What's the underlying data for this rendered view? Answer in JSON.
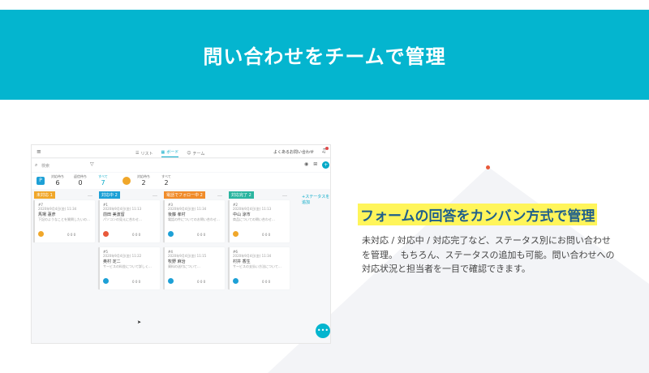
{
  "banner": {
    "title": "問い合わせをチームで管理"
  },
  "app": {
    "menu_icon": "hamburger-icon",
    "tabs": [
      {
        "label": "リスト",
        "icon": "list-icon",
        "active": false
      },
      {
        "label": "ボード",
        "icon": "board-icon",
        "active": true
      },
      {
        "label": "チーム",
        "icon": "team-icon",
        "active": false
      }
    ],
    "faq": "よくあるお問い合わせ",
    "search_placeholder": "検索",
    "stats": [
      {
        "label": "対応待ち",
        "value": "6"
      },
      {
        "label": "返信待ち",
        "value": "0"
      },
      {
        "label": "すべて",
        "value": "7",
        "active": true
      },
      {
        "label": "対応待ち",
        "value": "2"
      },
      {
        "label": "すべて",
        "value": "2"
      }
    ],
    "stat_badge": "P",
    "columns": [
      {
        "label": "未対応",
        "count": "1",
        "color": "#f0a72a"
      },
      {
        "label": "対応中",
        "count": "2",
        "color": "#1da0d6"
      },
      {
        "label": "電話でフォロー中",
        "count": "2",
        "color": "#f08c2a"
      },
      {
        "label": "対応完了",
        "count": "2",
        "color": "#2bb5a0"
      }
    ],
    "add_status": "+ステータスを追加",
    "cards": [
      {
        "no": "#7",
        "date": "2020年9月4日(金) 11:34",
        "name": "馬場 蓮彦",
        "desc": "下記のようなことを質問したいの…",
        "foot": "0 0 0"
      },
      {
        "no": "#1",
        "date": "2020年9月4日(金) 11:13",
        "name": "前田 美波留",
        "desc": "パソコンの見えに合わせ…",
        "foot": "0 0 0"
      },
      {
        "no": "#3",
        "date": "2020年9月4日(金) 11:34",
        "name": "後藤 孝村",
        "desc": "電話の件についてのお問い合わせ…",
        "foot": "0 0 0"
      },
      {
        "no": "#2",
        "date": "2020年9月4日(金) 11:13",
        "name": "中山 涼市",
        "desc": "商品についての問い合わせ…",
        "foot": "0 0 0"
      },
      {
        "no": "#5",
        "date": "2020年9月4日(金) 11:22",
        "name": "奥村 定二",
        "desc": "サービスの料金について詳しく…",
        "foot": "0 0 0"
      },
      {
        "no": "#4",
        "date": "2020年9月4日(金) 11:15",
        "name": "牧野 麻治",
        "desc": "資料の送付について…",
        "foot": "0 0 0"
      },
      {
        "no": "#6",
        "date": "2020年9月4日(金) 11:34",
        "name": "村井 香生",
        "desc": "サービスの支払い方法について…",
        "foot": "0 0 0"
      }
    ]
  },
  "feature": {
    "title": "フォームの回答をカンバン方式で管理",
    "body": "未対応 / 対応中 / 対応完了など、ステータス別にお問い合わせを管理。 もちろん、ステータスの追加も可能。問い合わせへの対応状況と担当者を一目で確認できます。"
  },
  "colors": {
    "banner": "#04b5cf",
    "highlight": "#fff55a",
    "heading": "#1f5f8b",
    "accent_dot": "#e8593a"
  }
}
